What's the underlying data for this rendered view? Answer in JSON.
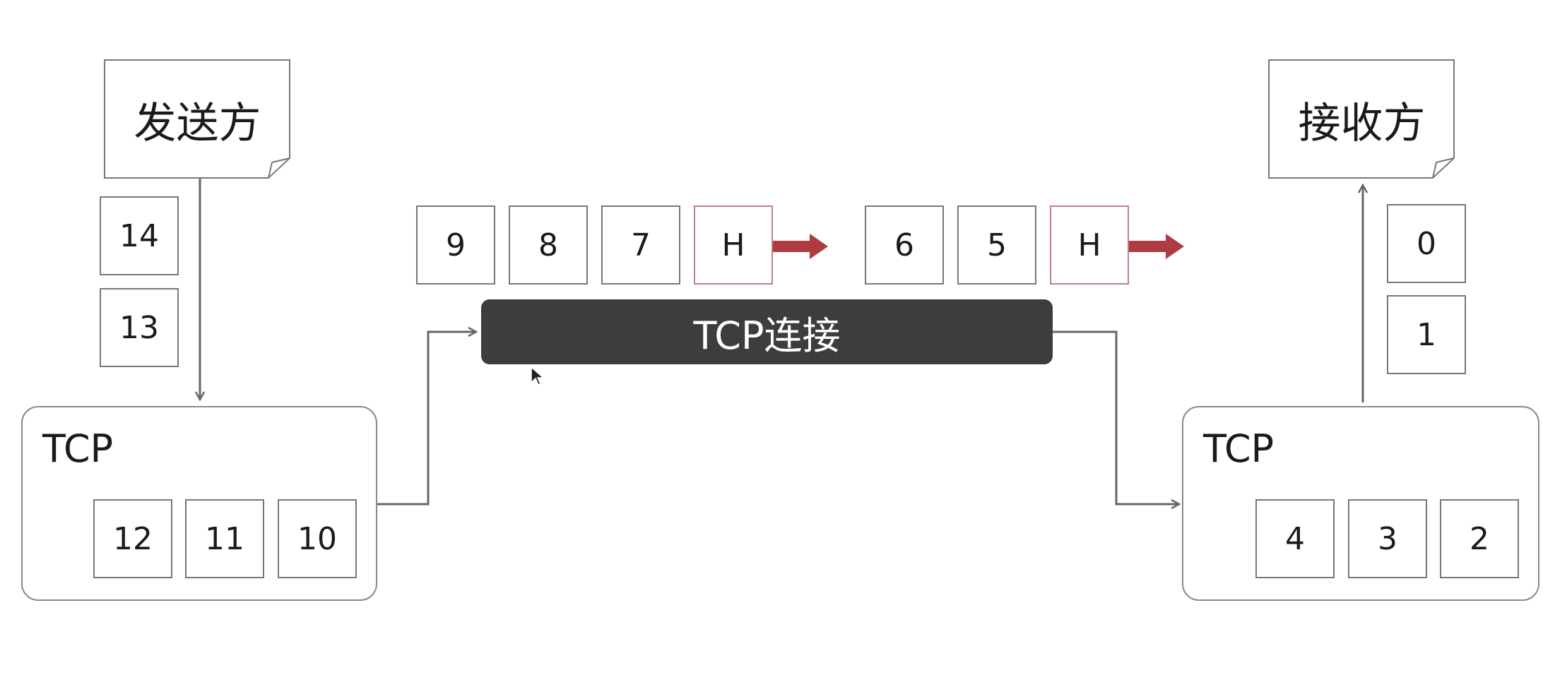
{
  "sender": {
    "label": "发送方",
    "queued_segments": [
      "14",
      "13"
    ],
    "tcp": {
      "label": "TCP",
      "buffer_segments": [
        "12",
        "11",
        "10"
      ]
    }
  },
  "connection": {
    "label": "TCP连接",
    "packets": [
      {
        "header": "H",
        "segments": [
          "9",
          "8",
          "7"
        ]
      },
      {
        "header": "H",
        "segments": [
          "6",
          "5"
        ]
      }
    ]
  },
  "receiver": {
    "label": "接收方",
    "delivered_segments": [
      "0",
      "1"
    ],
    "tcp": {
      "label": "TCP",
      "buffer_segments": [
        "4",
        "3",
        "2"
      ]
    }
  },
  "colors": {
    "connection_bar": "#3d3d3d",
    "packet_arrow": "#b03a42",
    "header_border": "#c27f86",
    "line": "#666666"
  }
}
